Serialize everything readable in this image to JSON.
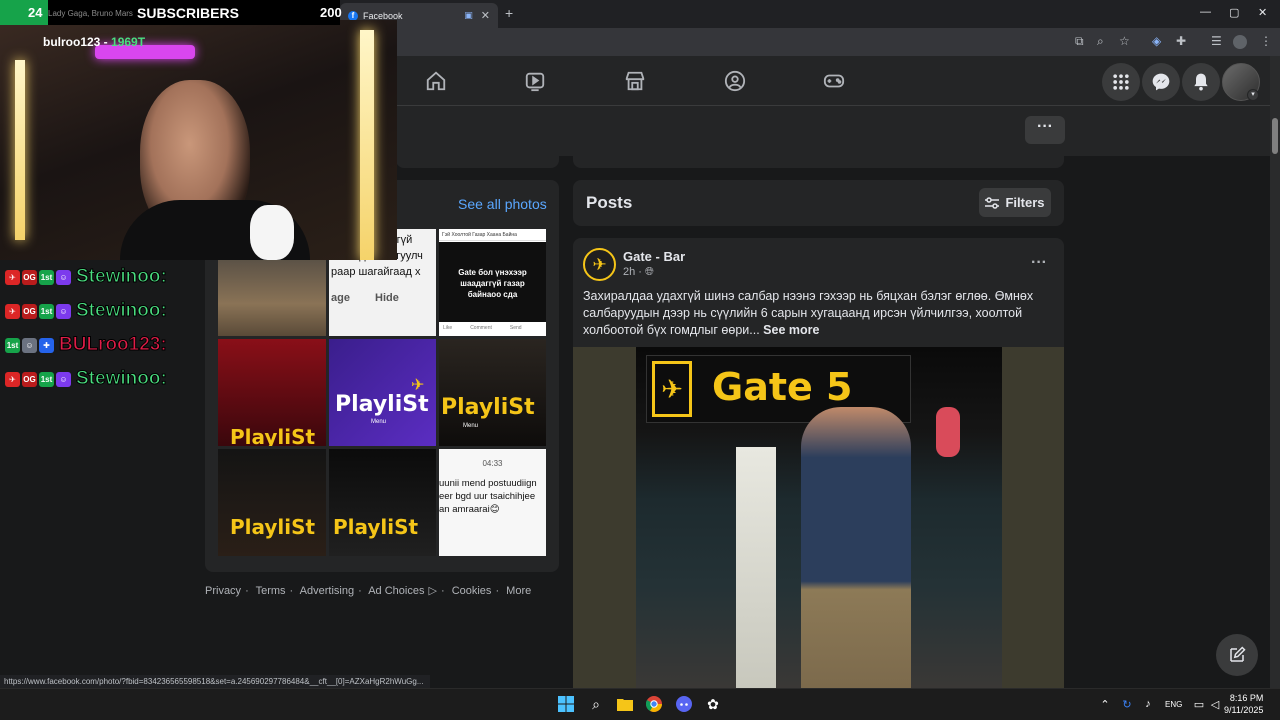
{
  "browser": {
    "tab_title": "Facebook",
    "new_tab_symbol": "+",
    "window_controls": [
      "—",
      "▢",
      "✕"
    ]
  },
  "fb": {
    "more_button": "···",
    "photos": {
      "see_all": "See all photos",
      "tile1_lines": [
        "к сэтэй хэрэггүй",
        "айгаад ш....лгуулч",
        "раар шагайгаад х"
      ],
      "tile1_actions": [
        "age",
        "Hide"
      ],
      "tile2_header": "Гэй Хоолтой Газар Хаана Байна",
      "tile2_text": "Gate бол үнэхээр шаадаггүй газар байнаоо сда",
      "tile2_actions": [
        "Like",
        "Comment",
        "Send"
      ],
      "playlist_word": "PlayliSt",
      "playlist_sub": "Menu",
      "chat_time": "04:33",
      "chat_text": "uunii mend postuudiign eer bgd uur tsaichihjee an amraarai😊"
    },
    "footer": [
      "Privacy",
      "·",
      "Terms",
      "·",
      "Advertising",
      "·",
      "Ad Choices",
      "▷",
      "·",
      "Cookies",
      "·",
      "More"
    ],
    "posts": {
      "title": "Posts",
      "filters": "Filters",
      "author": "Gate - Bar",
      "time": "2h ·",
      "text": "Захиралдаа удахгүй шинэ салбар нээнэ гэхээр нь бяцхан бэлэг өглөө. Өмнөх салбаруудын дээр нь сүүлийн 6 сарын хугацаанд ирсэн үйлчилгээ, хоолтой холбоотой бүх гомдлыг өөри...",
      "see_more": "See more",
      "image_sign": "Gate 5"
    }
  },
  "stream": {
    "sub_count": "24",
    "sub_song": "Lady Gaga, Bruno Mars",
    "sub_label": "SUBSCRIBERS",
    "sub_goal": "200",
    "cam_user": "bulroo123 -",
    "cam_user_num": "1969T",
    "chat": [
      {
        "name": "Stewinoo:",
        "color": "#4ade80"
      },
      {
        "name": "Stewinoo:",
        "color": "#4ade80"
      },
      {
        "name": "BULroo123:",
        "color": "#e11d48"
      },
      {
        "name": "Stewinoo:",
        "color": "#4ade80"
      }
    ]
  },
  "status_url": "https://www.facebook.com/photo/?fbid=834236565598518&set=a.245690297786484&__cft__[0]=AZXaHgR2hWuGg...",
  "taskbar": {
    "lang": "ENG",
    "time": "8:16 PM",
    "date": "9/11/2025"
  }
}
